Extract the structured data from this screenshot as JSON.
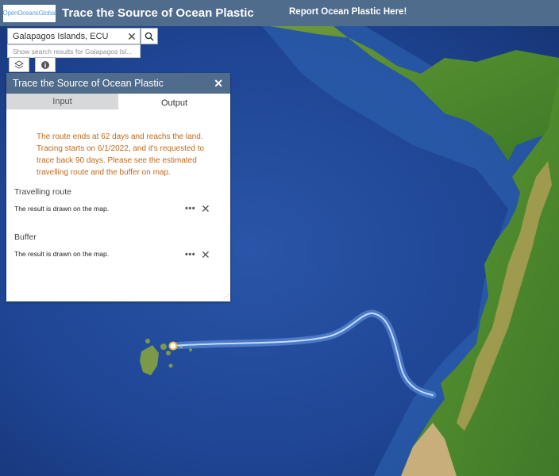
{
  "header": {
    "logo_text": "OpenOceansGlobal",
    "title": "Trace the Source of Ocean Plastic",
    "report_link": "Report Ocean Plastic Here!"
  },
  "search": {
    "value": "Galapagos Islands, ECU",
    "suggestion": "Show search results for Galapagos Isl..."
  },
  "map_buttons": [
    {
      "icon": "layers-icon"
    },
    {
      "icon": "info-icon"
    }
  ],
  "panel": {
    "title": "Trace the Source of Ocean Plastic",
    "tabs": [
      {
        "label": "Input",
        "active": false
      },
      {
        "label": "Output",
        "active": true
      }
    ],
    "message": "The route ends at 62 days and reachs the land. Tracing starts on 6/1/2022, and it's requested to trace back 90 days. Please see the estimated travelling route and the buffer on map.",
    "results": [
      {
        "label": "Travelling route",
        "text": "The result is drawn on the map."
      },
      {
        "label": "Buffer",
        "text": "The result is drawn on the map."
      }
    ]
  },
  "colors": {
    "header_bg": "#4f6c8c",
    "message_text": "#c36a1b",
    "ocean": "#1d3f86",
    "route": "#8fb5ea"
  }
}
